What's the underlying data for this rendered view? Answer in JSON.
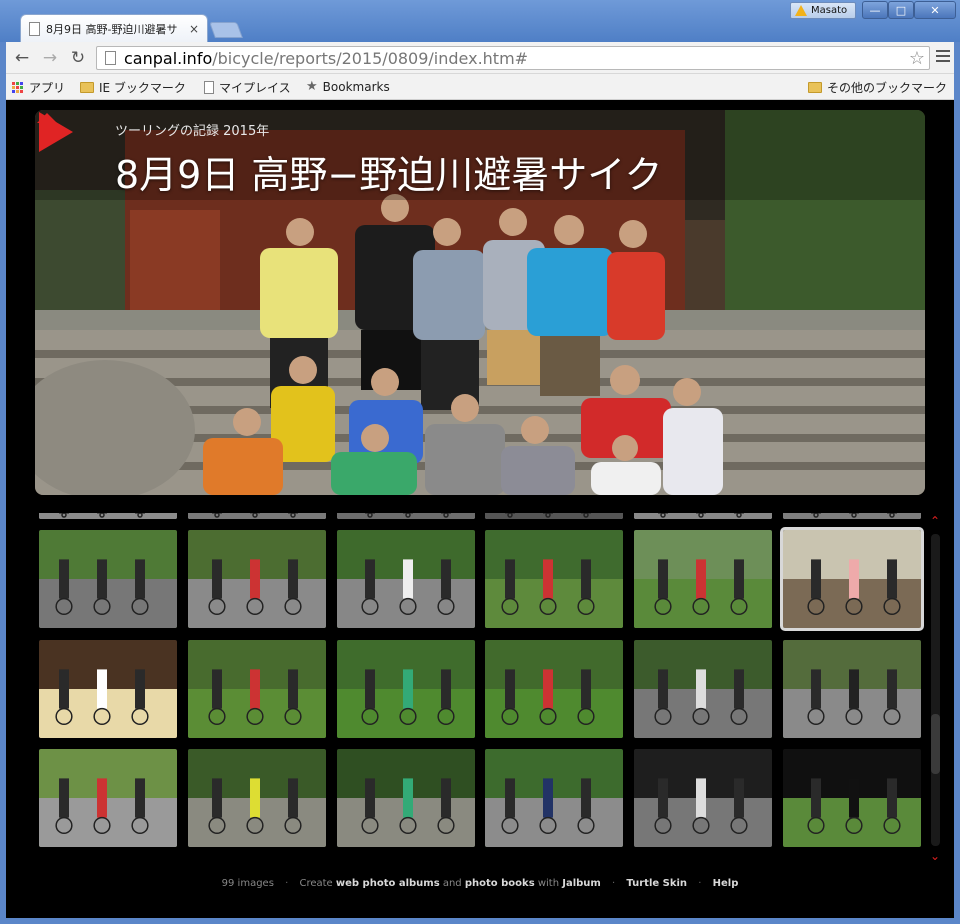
{
  "tab": {
    "title": "8月9日 高野-野迫川避暑サ",
    "close": "×"
  },
  "user": {
    "name": "Masato"
  },
  "window_buttons": {
    "minimize": "—",
    "maximize": "□",
    "close": "✕"
  },
  "nav": {
    "back": "←",
    "forward": "→",
    "reload": "↻"
  },
  "url": {
    "host": "canpal.info",
    "path": "/bicycle/reports/2015/0809/index.htm#"
  },
  "bookmarks": {
    "apps": "アプリ",
    "ie": "IE ブックマーク",
    "myplace": "マイプレイス",
    "bookmarks": "Bookmarks",
    "other": "その他のブックマーク"
  },
  "hero": {
    "subtitle": "ツーリングの記録 2015年",
    "title": "8月9日 高野−野迫川避暑サイク"
  },
  "footer": {
    "count": "99 images",
    "create": "Create",
    "web_albums": "web photo albums",
    "and": "and",
    "photo_books": "photo books",
    "with": "with",
    "jalbum": "Jalbum",
    "skin": "Turtle Skin",
    "help": "Help"
  },
  "colors": {
    "accent_red": "#e02424",
    "page_bg": "#000000",
    "chrome_blue": "#5b86c9"
  },
  "thumbnails": [
    {
      "name": "thumb-1",
      "sky": "#b9b9b9",
      "ground": "#8c8c8c",
      "accent": "#333"
    },
    {
      "name": "thumb-2",
      "sky": "#cfcfcf",
      "ground": "#7a7a7a",
      "accent": "#444"
    },
    {
      "name": "thumb-3",
      "sky": "#9e9e9e",
      "ground": "#6d6d6d",
      "accent": "#333"
    },
    {
      "name": "thumb-4",
      "sky": "#8d8d8d",
      "ground": "#555",
      "accent": "#222"
    },
    {
      "name": "thumb-5",
      "sky": "#c7c7c7",
      "ground": "#888",
      "accent": "#333"
    },
    {
      "name": "thumb-6",
      "sky": "#b0b0b0",
      "ground": "#7e7e7e",
      "accent": "#333"
    },
    {
      "name": "thumb-7",
      "sky": "#4f7a36",
      "ground": "#777",
      "accent": "#2a2a2a"
    },
    {
      "name": "thumb-8",
      "sky": "#4c6d31",
      "ground": "#8a8a8a",
      "accent": "#c33"
    },
    {
      "name": "thumb-9",
      "sky": "#3e6a2c",
      "ground": "#878787",
      "accent": "#eee"
    },
    {
      "name": "thumb-10",
      "sky": "#3f6b2e",
      "ground": "#5e8a3c",
      "accent": "#c33"
    },
    {
      "name": "thumb-11",
      "sky": "#6d8f58",
      "ground": "#5a8a3a",
      "accent": "#c33"
    },
    {
      "name": "thumb-12",
      "sky": "#c9c4b0",
      "ground": "#7b6a55",
      "accent": "#eaa"
    },
    {
      "name": "thumb-13",
      "sky": "#4a3322",
      "ground": "#e8d9a8",
      "accent": "#fff"
    },
    {
      "name": "thumb-14",
      "sky": "#486b2e",
      "ground": "#5b8d35",
      "accent": "#c33"
    },
    {
      "name": "thumb-15",
      "sky": "#3f6c2c",
      "ground": "#4f8a2f",
      "accent": "#3a7"
    },
    {
      "name": "thumb-16",
      "sky": "#416a2c",
      "ground": "#4f8a2f",
      "accent": "#c33"
    },
    {
      "name": "thumb-17",
      "sky": "#3c5b2c",
      "ground": "#777",
      "accent": "#ddd"
    },
    {
      "name": "thumb-18",
      "sky": "#546c3c",
      "ground": "#8a8a8a",
      "accent": "#222"
    },
    {
      "name": "thumb-19",
      "sky": "#6d9146",
      "ground": "#9a9a9a",
      "accent": "#c33"
    },
    {
      "name": "thumb-20",
      "sky": "#3a5a28",
      "ground": "#8a8a80",
      "accent": "#dd3"
    },
    {
      "name": "thumb-21",
      "sky": "#2f4f22",
      "ground": "#8a8a80",
      "accent": "#3a7"
    },
    {
      "name": "thumb-22",
      "sky": "#3d6b2d",
      "ground": "#8c8c8c",
      "accent": "#236"
    },
    {
      "name": "thumb-23",
      "sky": "#1e1e1e",
      "ground": "#777",
      "accent": "#ddd"
    },
    {
      "name": "thumb-24",
      "sky": "#101010",
      "ground": "#5a8a3a",
      "accent": "#111"
    }
  ]
}
